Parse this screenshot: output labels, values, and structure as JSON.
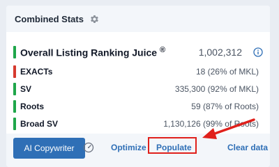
{
  "card": {
    "title": "Combined Stats",
    "settings_icon": "gear-icon"
  },
  "stats": {
    "main": {
      "label": "Overall Listing Ranking Juice",
      "trademark": "®",
      "value": "1,002,312",
      "indicator_color": "#1fa64a",
      "info_icon": "info-circle-icon"
    },
    "rows": [
      {
        "label": "EXACTs",
        "value": "18 (26% of MKL)",
        "indicator_color": "#d63a2f"
      },
      {
        "label": "SV",
        "value": "335,300 (92% of MKL)",
        "indicator_color": "#1fa64a"
      },
      {
        "label": "Roots",
        "value": "59 (87% of Roots)",
        "indicator_color": "#1fa64a"
      },
      {
        "label": "Broad SV",
        "value": "1,130,126 (99% of Roots)",
        "indicator_color": "#1fa64a"
      }
    ]
  },
  "footer": {
    "ai_copywriter": "AI Copywriter",
    "gauge_icon": "gauge-icon",
    "optimize": "Optimize",
    "populate": "Populate",
    "clear_data": "Clear data"
  },
  "colors": {
    "accent": "#2f6fb6",
    "annotation": "#e0201b"
  }
}
